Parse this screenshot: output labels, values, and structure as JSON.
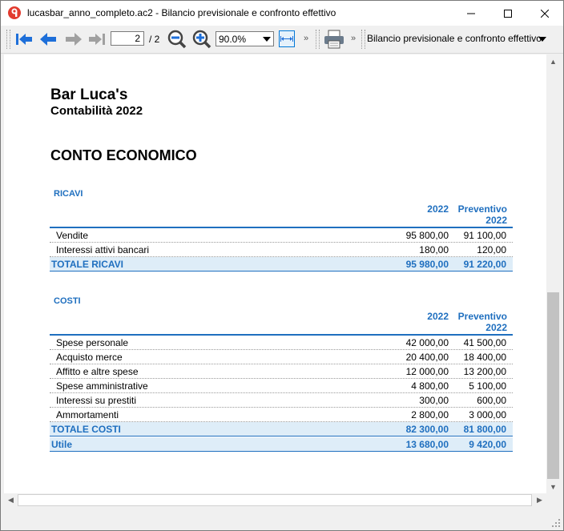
{
  "window": {
    "title": "lucasbar_anno_completo.ac2 - Bilancio previsionale e confronto effettivo",
    "minimize_icon": "minimize-icon",
    "maximize_icon": "maximize-icon",
    "close_icon": "close-icon"
  },
  "toolbar": {
    "page_current": "2",
    "page_total": "/ 2",
    "zoom": "90.0%",
    "more": "»",
    "report_name": "Bilancio previsionale e confronto effettivo",
    "colors": {
      "arrow_blue": "#1e6fd9",
      "arrow_gray": "#a0a0a0"
    }
  },
  "report": {
    "company": "Bar Luca's",
    "subtitle": "Contabilità 2022",
    "heading": "CONTO ECONOMICO",
    "accent_color": "#1f6fbf",
    "ricavi": {
      "title": "RICAVI",
      "col1": "2022",
      "col2_line1": "Preventivo",
      "col2_line2": "2022",
      "rows": [
        {
          "label": "Vendite",
          "v1": "95 800,00",
          "v2": "91 100,00"
        },
        {
          "label": "Interessi attivi bancari",
          "v1": "180,00",
          "v2": "120,00"
        }
      ],
      "total": {
        "label": "TOTALE RICAVI",
        "v1": "95 980,00",
        "v2": "91 220,00"
      }
    },
    "costi": {
      "title": "COSTI",
      "col1": "2022",
      "col2_line1": "Preventivo",
      "col2_line2": "2022",
      "rows": [
        {
          "label": "Spese personale",
          "v1": "42 000,00",
          "v2": "41 500,00"
        },
        {
          "label": "Acquisto merce",
          "v1": "20 400,00",
          "v2": "18 400,00"
        },
        {
          "label": "Affitto e altre spese",
          "v1": "12 000,00",
          "v2": "13 200,00"
        },
        {
          "label": "Spese amministrative",
          "v1": "4 800,00",
          "v2": "5 100,00"
        },
        {
          "label": "Interessi su prestiti",
          "v1": "300,00",
          "v2": "600,00"
        },
        {
          "label": "Ammortamenti",
          "v1": "2 800,00",
          "v2": "3 000,00"
        }
      ],
      "total": {
        "label": "TOTALE COSTI",
        "v1": "82 300,00",
        "v2": "81 800,00"
      },
      "utile": {
        "label": "Utile",
        "v1": "13 680,00",
        "v2": "9 420,00"
      }
    }
  }
}
